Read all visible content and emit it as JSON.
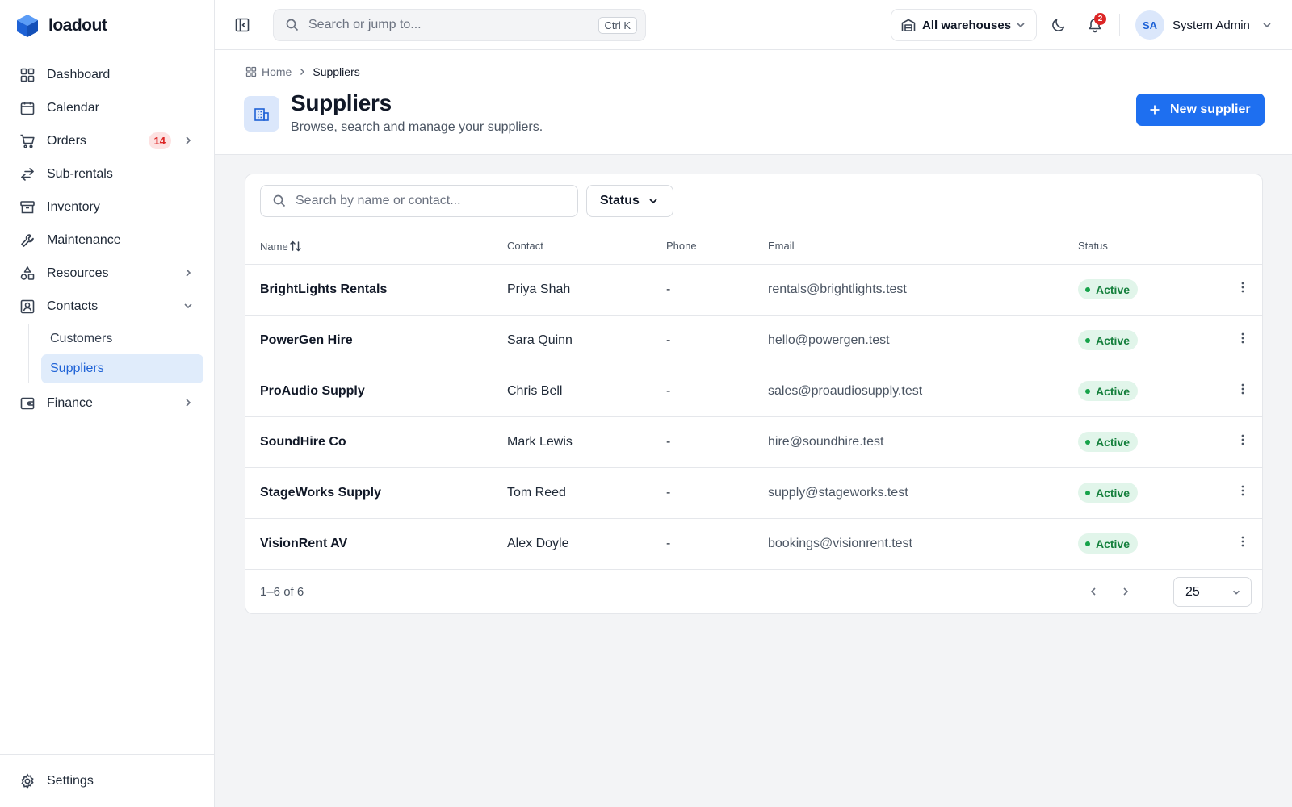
{
  "app": {
    "name": "loadout"
  },
  "sidebar": {
    "items": [
      {
        "label": "Dashboard",
        "icon": "dashboard-icon"
      },
      {
        "label": "Calendar",
        "icon": "calendar-icon"
      },
      {
        "label": "Orders",
        "icon": "cart-icon",
        "badge": "14"
      },
      {
        "label": "Sub-rentals",
        "icon": "swap-icon"
      },
      {
        "label": "Inventory",
        "icon": "archive-icon"
      },
      {
        "label": "Maintenance",
        "icon": "wrench-icon"
      },
      {
        "label": "Resources",
        "icon": "shapes-icon"
      },
      {
        "label": "Contacts",
        "icon": "contacts-icon"
      },
      {
        "label": "Finance",
        "icon": "wallet-icon"
      }
    ],
    "contacts_sub": [
      {
        "label": "Customers"
      },
      {
        "label": "Suppliers",
        "active": true
      }
    ],
    "settings_label": "Settings"
  },
  "topbar": {
    "search_placeholder": "Search or jump to...",
    "search_shortcut": "Ctrl K",
    "warehouse_label": "All warehouses",
    "notification_count": "2",
    "user_initials": "SA",
    "user_name": "System Admin"
  },
  "page": {
    "breadcrumb_home": "Home",
    "breadcrumb_current": "Suppliers",
    "title": "Suppliers",
    "subtitle": "Browse, search and manage your suppliers.",
    "new_button": "New supplier"
  },
  "table": {
    "search_placeholder": "Search by name or contact...",
    "status_filter": "Status",
    "columns": {
      "name": "Name",
      "contact": "Contact",
      "phone": "Phone",
      "email": "Email",
      "status": "Status"
    },
    "rows": [
      {
        "name": "BrightLights Rentals",
        "contact": "Priya Shah",
        "phone": "-",
        "email": "rentals@brightlights.test",
        "status": "Active"
      },
      {
        "name": "PowerGen Hire",
        "contact": "Sara Quinn",
        "phone": "-",
        "email": "hello@powergen.test",
        "status": "Active"
      },
      {
        "name": "ProAudio Supply",
        "contact": "Chris Bell",
        "phone": "-",
        "email": "sales@proaudiosupply.test",
        "status": "Active"
      },
      {
        "name": "SoundHire Co",
        "contact": "Mark Lewis",
        "phone": "-",
        "email": "hire@soundhire.test",
        "status": "Active"
      },
      {
        "name": "StageWorks Supply",
        "contact": "Tom Reed",
        "phone": "-",
        "email": "supply@stageworks.test",
        "status": "Active"
      },
      {
        "name": "VisionRent AV",
        "contact": "Alex Doyle",
        "phone": "-",
        "email": "bookings@visionrent.test",
        "status": "Active"
      }
    ],
    "count_text": "1–6 of 6",
    "per_page": "25"
  },
  "colors": {
    "accent": "#1e6ff0",
    "active_bg": "#e1f5ea",
    "active_text": "#15803d",
    "badge_red": "#dc2626"
  }
}
